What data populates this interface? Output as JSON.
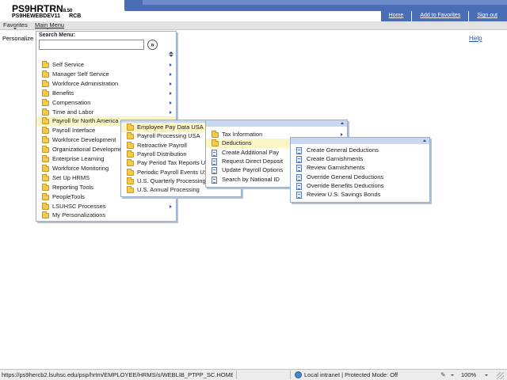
{
  "header": {
    "title": "PS9HRTRN",
    "version": "8.50",
    "server": "PS9HEWEBDEV11",
    "user": "RCB",
    "links": [
      "Home",
      "Add to Favorites",
      "Sign out"
    ]
  },
  "menubar": {
    "favorites": "Favorites",
    "main_menu": "Main Menu"
  },
  "page": {
    "personalize": "Personalize",
    "help": "Help"
  },
  "main_menu": {
    "search_label": "Search Menu:",
    "search_value": "",
    "search_go": "»",
    "items": [
      {
        "label": "Self Service",
        "type": "folder",
        "submenu": true
      },
      {
        "label": "Manager Self Service",
        "type": "folder",
        "submenu": true
      },
      {
        "label": "Workforce Administration",
        "type": "folder",
        "submenu": true
      },
      {
        "label": "Benefits",
        "type": "folder",
        "submenu": true
      },
      {
        "label": "Compensation",
        "type": "folder",
        "submenu": true
      },
      {
        "label": "Time and Labor",
        "type": "folder",
        "submenu": true
      },
      {
        "label": "Payroll for North America",
        "type": "folder",
        "submenu": true,
        "highlighted": true
      },
      {
        "label": "Payroll Interface",
        "type": "folder",
        "submenu": true
      },
      {
        "label": "Workforce Development",
        "type": "folder",
        "submenu": true
      },
      {
        "label": "Organizational Development",
        "type": "folder",
        "submenu": true
      },
      {
        "label": "Enterprise Learning",
        "type": "folder",
        "submenu": true
      },
      {
        "label": "Workforce Monitoring",
        "type": "folder",
        "submenu": true
      },
      {
        "label": "Set Up HRMS",
        "type": "folder",
        "submenu": true
      },
      {
        "label": "Reporting Tools",
        "type": "folder",
        "submenu": true
      },
      {
        "label": "PeopleTools",
        "type": "folder",
        "submenu": true
      },
      {
        "label": "LSUHSC Processes",
        "type": "folder",
        "submenu": true
      },
      {
        "label": "My Personalizations",
        "type": "folder",
        "submenu": false
      }
    ]
  },
  "payroll_menu": {
    "items": [
      {
        "label": "Employee Pay Data USA",
        "type": "folder",
        "highlighted": true
      },
      {
        "label": "Payroll Processing USA",
        "type": "folder"
      },
      {
        "label": "Retroactive Payroll",
        "type": "folder"
      },
      {
        "label": "Payroll Distribution",
        "type": "folder"
      },
      {
        "label": "Pay Period Tax Reports USA",
        "type": "folder"
      },
      {
        "label": "Periodic Payroll Events USA",
        "type": "folder"
      },
      {
        "label": "U.S. Quarterly Processing",
        "type": "folder"
      },
      {
        "label": "U.S. Annual Processing",
        "type": "folder"
      }
    ]
  },
  "pay_data_menu": {
    "items": [
      {
        "label": "Tax Information",
        "type": "folder",
        "submenu": true
      },
      {
        "label": "Deductions",
        "type": "folder",
        "highlighted": true
      },
      {
        "label": "Create Additional Pay",
        "type": "doc"
      },
      {
        "label": "Request Direct Deposit",
        "type": "doc"
      },
      {
        "label": "Update Payroll Options",
        "type": "doc"
      },
      {
        "label": "Search by National ID",
        "type": "doc"
      }
    ]
  },
  "deductions_menu": {
    "items": [
      {
        "label": "Create General Deductions",
        "type": "doc"
      },
      {
        "label": "Create Garnishments",
        "type": "doc"
      },
      {
        "label": "Review Garnishments",
        "type": "doc"
      },
      {
        "label": "Override General Deductions",
        "type": "doc"
      },
      {
        "label": "Override Benefits Deductions",
        "type": "doc"
      },
      {
        "label": "Review U.S. Savings Bonds",
        "type": "doc"
      }
    ]
  },
  "statusbar": {
    "url": "https://ps9hercb2.lsuhsc.edu/psp/hrtrn/EMPLOYEE/HRMS/s/WEBLIB_PTPP_SC.HOMEPAGE",
    "zone": "Local intranet | Protected Mode: Off",
    "zoom": "100%"
  },
  "colors": {
    "header_blue": "#4a6db5",
    "menu_head": "#c9d8ee",
    "highlight": "#fbf6c5",
    "folder": "#f5c94a"
  }
}
